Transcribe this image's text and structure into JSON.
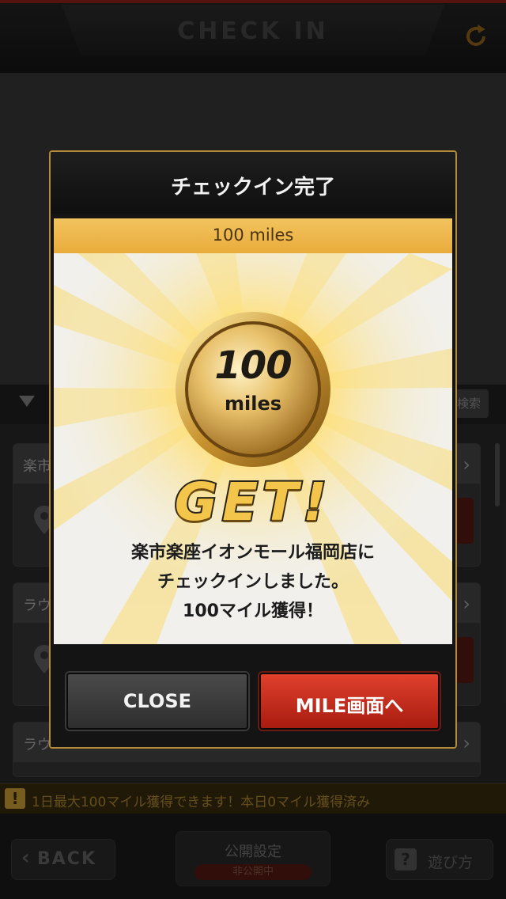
{
  "app": {
    "title": "CHECK IN",
    "refresh_icon": "refresh-icon"
  },
  "list": {
    "search_label": "検索",
    "shops": [
      {
        "name": "楽市"
      },
      {
        "name": "ラウ"
      },
      {
        "name": "ラウ"
      }
    ]
  },
  "notice": {
    "icon": "!",
    "text": "1日最大100マイル獲得できます！本日0マイル獲得済み"
  },
  "bottom_bar": {
    "back_label": "BACK",
    "privacy_label": "公開設定",
    "privacy_status": "非公開中",
    "help_icon": "?",
    "help_label": "遊び方"
  },
  "modal": {
    "title": "チェックイン完了",
    "reward_banner": "100 miles",
    "coin_value": "100",
    "coin_unit": "miles",
    "get_text": "GET!",
    "message_line1": "楽市楽座イオンモール福岡店に",
    "message_line2": "チェックインしました。",
    "message_line3": "100マイル獲得！",
    "close_label": "CLOSE",
    "mile_label": "MILE画面へ"
  },
  "colors": {
    "accent_gold": "#f2c35e",
    "accent_red": "#c82a1a",
    "modal_border": "#b68a3a"
  }
}
